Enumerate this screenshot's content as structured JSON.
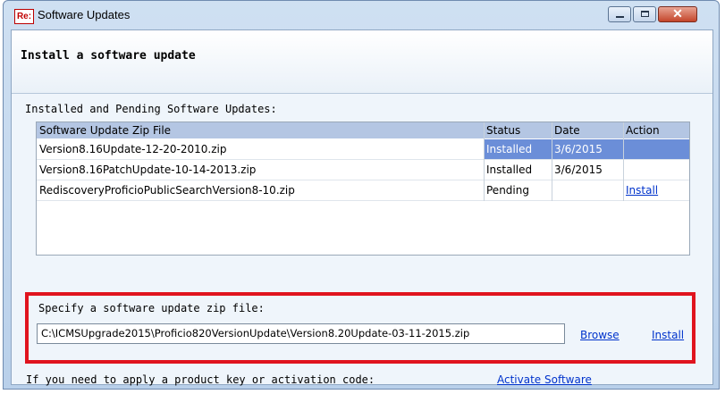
{
  "window": {
    "app_icon_text": "Re:",
    "title": "Software Updates",
    "close_glyph": "✕"
  },
  "header": {
    "title": "Install a software update"
  },
  "updates": {
    "section_label": "Installed and Pending Software Updates:",
    "columns": [
      "Software Update Zip File",
      "Status",
      "Date",
      "Action"
    ],
    "rows": [
      {
        "file": "Version8.16Update-12-20-2010.zip",
        "status": "Installed",
        "date": "3/6/2015",
        "action": "",
        "selected": true
      },
      {
        "file": "Version8.16PatchUpdate-10-14-2013.zip",
        "status": "Installed",
        "date": "3/6/2015",
        "action": "",
        "selected": false
      },
      {
        "file": "RediscoveryProficioPublicSearchVersion8-10.zip",
        "status": "Pending",
        "date": "",
        "action": "Install",
        "selected": false
      }
    ]
  },
  "zip": {
    "label": "Specify a software update zip file:",
    "path_value": "C:\\ICMSUpgrade2015\\Proficio820VersionUpdate\\Version8.20Update-03-11-2015.zip",
    "browse_label": "Browse",
    "install_label": "Install"
  },
  "activation": {
    "label": "If you need to apply a product key or activation code:",
    "link_label": "Activate Software"
  },
  "colors": {
    "selection": "#6b8ed8",
    "highlight_border": "#e0141e",
    "link": "#0033cc"
  }
}
